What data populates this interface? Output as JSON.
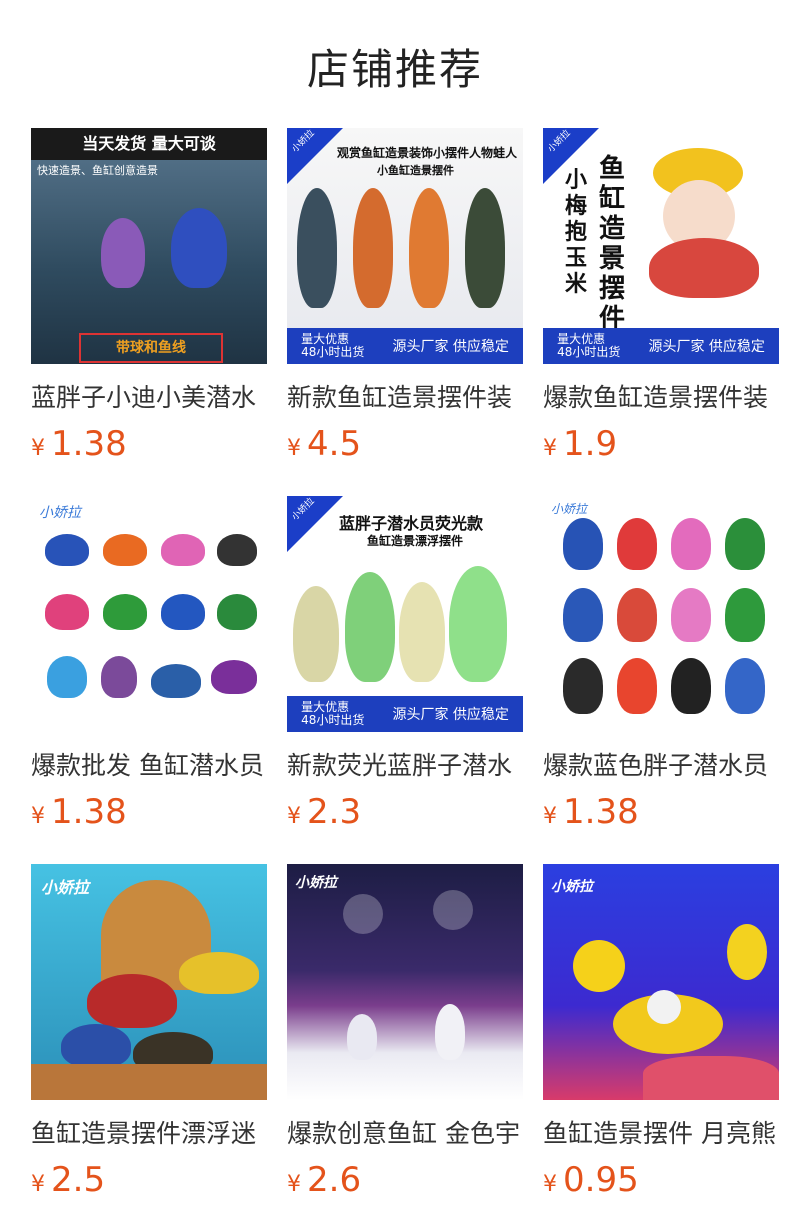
{
  "section": {
    "title": "店铺推荐"
  },
  "currency": "¥",
  "products": [
    {
      "name": "蓝胖子小迪小美潜水",
      "price": "1.38",
      "img_text": [
        "当天发货 量大可谈",
        "快速造景、鱼缸创意造景",
        "带球和鱼线"
      ],
      "bg": "#3c5a73"
    },
    {
      "name": "新款鱼缸造景摆件装",
      "price": "4.5",
      "img_text": [
        "小娇拉",
        "观赏鱼缸造景装饰小摆件人物蛙人",
        "小鱼缸造景摆件",
        "量大优惠",
        "48小时出货",
        "源头厂家 供应稳定"
      ],
      "bg": "#f2f2f2"
    },
    {
      "name": "爆款鱼缸造景摆件装",
      "price": "1.9",
      "img_text": [
        "小娇拉",
        "鱼缸造景摆件",
        "小梅抱玉米",
        "量大优惠",
        "48小时出货",
        "源头厂家 供应稳定"
      ],
      "bg": "#ffffff"
    },
    {
      "name": "爆款批发 鱼缸潜水员",
      "price": "1.38",
      "img_text": [
        "小娇拉"
      ],
      "bg": "#ffffff"
    },
    {
      "name": "新款荧光蓝胖子潜水",
      "price": "2.3",
      "img_text": [
        "小娇拉",
        "蓝胖子潜水员荧光款",
        "鱼缸造景漂浮摆件",
        "量大优惠",
        "48小时出货",
        "源头厂家 供应稳定"
      ],
      "bg": "#ffffff"
    },
    {
      "name": "爆款蓝色胖子潜水员",
      "price": "1.38",
      "img_text": [
        "小娇拉"
      ],
      "bg": "#ffffff"
    },
    {
      "name": "鱼缸造景摆件漂浮迷",
      "price": "2.5",
      "img_text": [
        "小娇拉"
      ],
      "bg": "#3fb2d6"
    },
    {
      "name": "爆款创意鱼缸 金色宇",
      "price": "2.6",
      "img_text": [
        "小娇拉"
      ],
      "bg": "#23234f"
    },
    {
      "name": "鱼缸造景摆件 月亮熊",
      "price": "0.95",
      "img_text": [
        "小娇拉"
      ],
      "bg": "#2a3fd8"
    }
  ]
}
